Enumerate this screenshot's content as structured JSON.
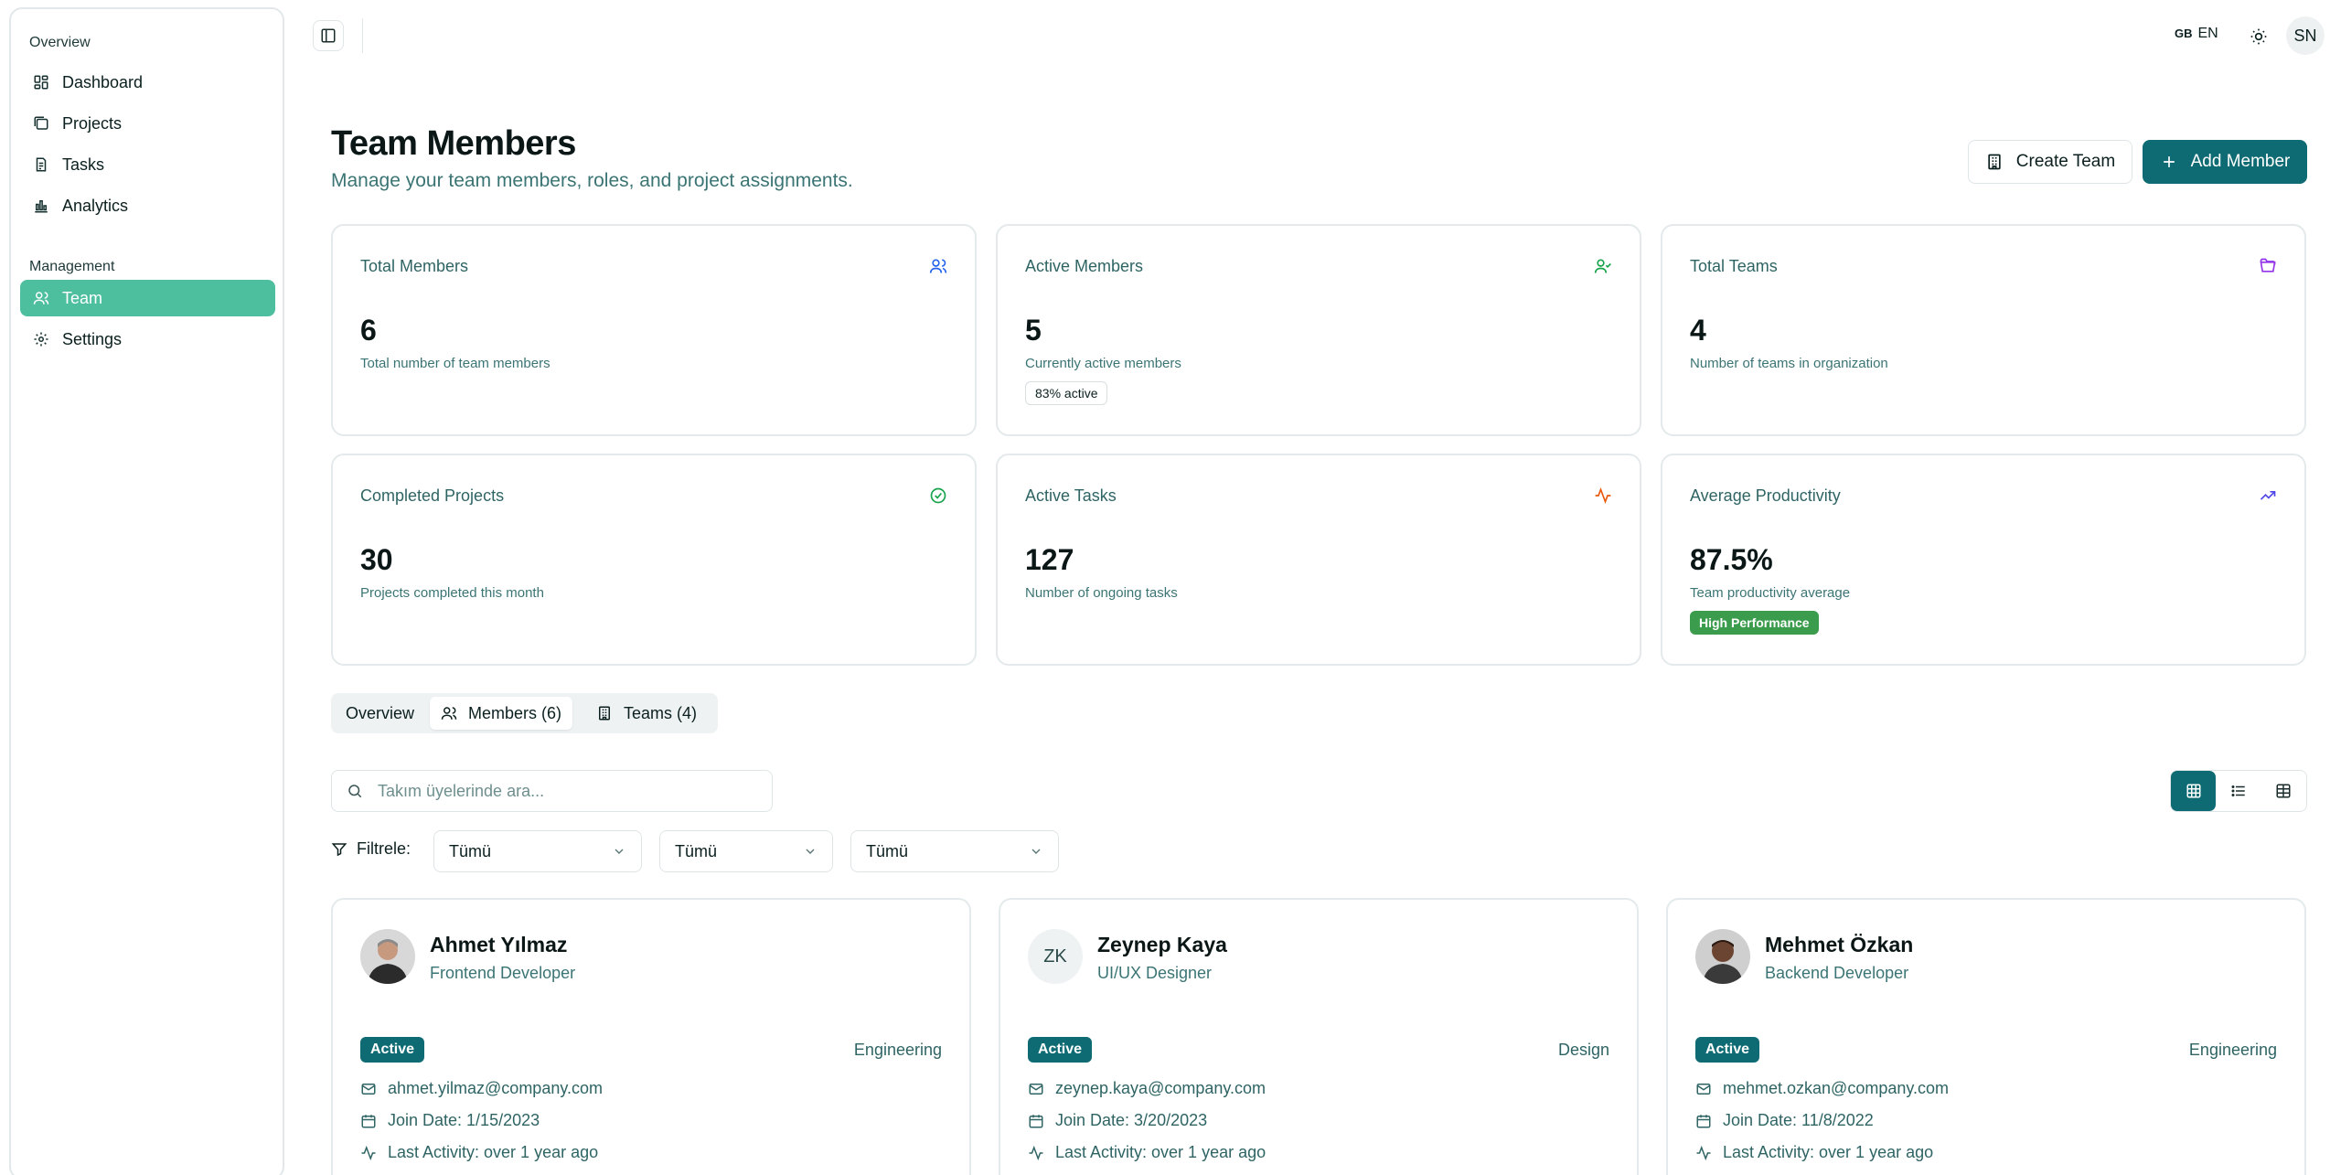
{
  "sidebar": {
    "group_overview": "Overview",
    "group_management": "Management",
    "items": [
      {
        "label": "Dashboard",
        "icon": "dashboard-icon"
      },
      {
        "label": "Projects",
        "icon": "folders-icon"
      },
      {
        "label": "Tasks",
        "icon": "clipboard-icon"
      },
      {
        "label": "Analytics",
        "icon": "bar-chart-icon"
      },
      {
        "label": "Team",
        "icon": "user-icon",
        "active": true
      },
      {
        "label": "Settings",
        "icon": "gear-icon"
      }
    ],
    "active_color": "#4dbf9f"
  },
  "topbar": {
    "lang_flag": "GB",
    "lang_code": "EN",
    "user_initials": "SN"
  },
  "header": {
    "title": "Team Members",
    "subtitle": "Manage your team members, roles, and project assignments.",
    "create_team_label": "Create Team",
    "add_member_label": "Add Member",
    "accent_color": "#0e6b73"
  },
  "stats": [
    {
      "title": "Total Members",
      "value": "6",
      "desc": "Total number of team members",
      "icon": "users-icon",
      "icon_color": "#2563eb"
    },
    {
      "title": "Active Members",
      "value": "5",
      "desc": "Currently active members",
      "badge": "83% active",
      "icon": "user-check-icon",
      "icon_color": "#16a34a"
    },
    {
      "title": "Total Teams",
      "value": "4",
      "desc": "Number of teams in organization",
      "icon": "folder-open-icon",
      "icon_color": "#9333ea"
    },
    {
      "title": "Completed Projects",
      "value": "30",
      "desc": "Projects completed this month",
      "icon": "check-circle-icon",
      "icon_color": "#16a34a"
    },
    {
      "title": "Active Tasks",
      "value": "127",
      "desc": "Number of ongoing tasks",
      "icon": "activity-icon",
      "icon_color": "#ea580c"
    },
    {
      "title": "Average Productivity",
      "value": "87.5%",
      "desc": "Team productivity average",
      "badge": "High Performance",
      "icon": "trending-up-icon",
      "icon_color": "#4f46e5"
    }
  ],
  "tabs": [
    {
      "label": "Overview"
    },
    {
      "label": "Members (6)",
      "active": true
    },
    {
      "label": "Teams (4)"
    }
  ],
  "search": {
    "placeholder": "Takım üyelerinde ara..."
  },
  "filters": {
    "label": "Filtrele:",
    "selects": [
      "Tümü",
      "Tümü",
      "Tümü"
    ]
  },
  "members": [
    {
      "name": "Ahmet Yılmaz",
      "role": "Frontend Developer",
      "status": "Active",
      "department": "Engineering",
      "email": "ahmet.yilmaz@company.com",
      "join": "Join Date: 1/15/2023",
      "activity": "Last Activity: over 1 year ago"
    },
    {
      "name": "Zeynep Kaya",
      "initials": "ZK",
      "role": "UI/UX Designer",
      "status": "Active",
      "department": "Design",
      "email": "zeynep.kaya@company.com",
      "join": "Join Date: 3/20/2023",
      "activity": "Last Activity: over 1 year ago"
    },
    {
      "name": "Mehmet Özkan",
      "role": "Backend Developer",
      "status": "Active",
      "department": "Engineering",
      "email": "mehmet.ozkan@company.com",
      "join": "Join Date: 11/8/2022",
      "activity": "Last Activity: over 1 year ago"
    }
  ]
}
